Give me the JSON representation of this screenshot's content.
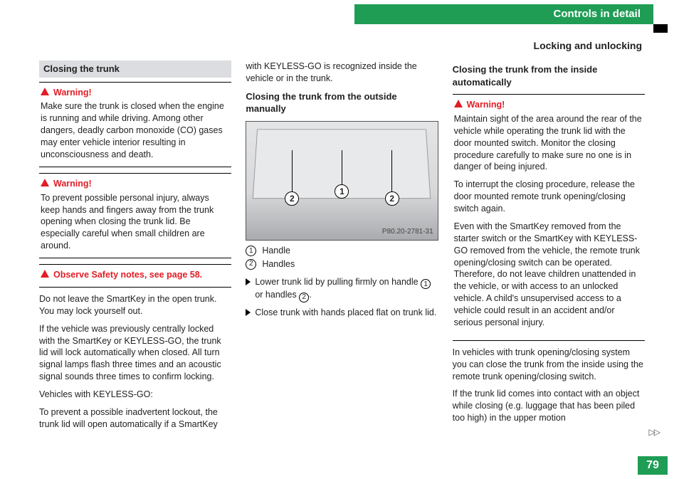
{
  "header": {
    "chapter": "Controls in detail",
    "section": "Locking and unlocking",
    "page_number": "79"
  },
  "col1": {
    "section_head": "Closing the trunk",
    "warn1_label": "Warning!",
    "warn1_body": "Make sure the trunk is closed when the engine is running and while driving. Among other dangers, deadly carbon monoxide (CO) gases may enter vehicle interior resulting in unconsciousness and death.",
    "warn2_label": "Warning!",
    "warn2_body": "To prevent possible personal injury, always keep hands and fingers away from the trunk opening when closing the trunk lid. Be especially careful when small children are around.",
    "safety_ref": "Observe Safety notes, see page 58.",
    "p1": "Do not leave the SmartKey in the open trunk. You may lock yourself out.",
    "p2": "If the vehicle was previously centrally locked with the SmartKey or KEYLESS-GO, the trunk lid will lock automatically when closed. All turn signal lamps flash three times and an acoustic signal sounds three times to confirm locking.",
    "p3": "Vehicles with KEYLESS-GO:",
    "p4": "To prevent a possible inadvertent lockout, the trunk lid will open automatically if a SmartKey"
  },
  "col2": {
    "cont": "with KEYLESS-GO is recognized inside the vehicle or in the trunk.",
    "h_outside": "Closing the trunk from the outside manually",
    "fig_label": "P80.20-2781-31",
    "legend1": "Handle",
    "legend2": "Handles",
    "step1_a": "Lower trunk lid by pulling firmly on handle ",
    "step1_b": " or handles ",
    "step1_c": ".",
    "step2": "Close trunk with hands placed flat on trunk lid."
  },
  "col3": {
    "h_inside": "Closing the trunk from the inside automatically",
    "warn_label": "Warning!",
    "warn_p1": "Maintain sight of the area around the rear of the vehicle while operating the trunk lid with the door mounted switch. Monitor the closing procedure carefully to make sure no one is in danger of being injured.",
    "warn_p2": "To interrupt the closing procedure, release the door mounted remote trunk opening/closing switch again.",
    "warn_p3": "Even with the SmartKey removed from the starter switch or the SmartKey with KEYLESS-GO removed from the vehicle, the remote trunk opening/closing switch can be operated. Therefore, do not leave children unattended in the vehicle, or with access to an unlocked vehicle. A child's unsupervised access to a vehicle could result in an accident and/or serious personal injury.",
    "p1": "In vehicles with trunk opening/closing system you can close the trunk from the inside using the remote trunk opening/closing switch.",
    "p2": "If the trunk lid comes into contact with an object while closing (e.g. luggage that has been piled too high) in the upper motion"
  }
}
